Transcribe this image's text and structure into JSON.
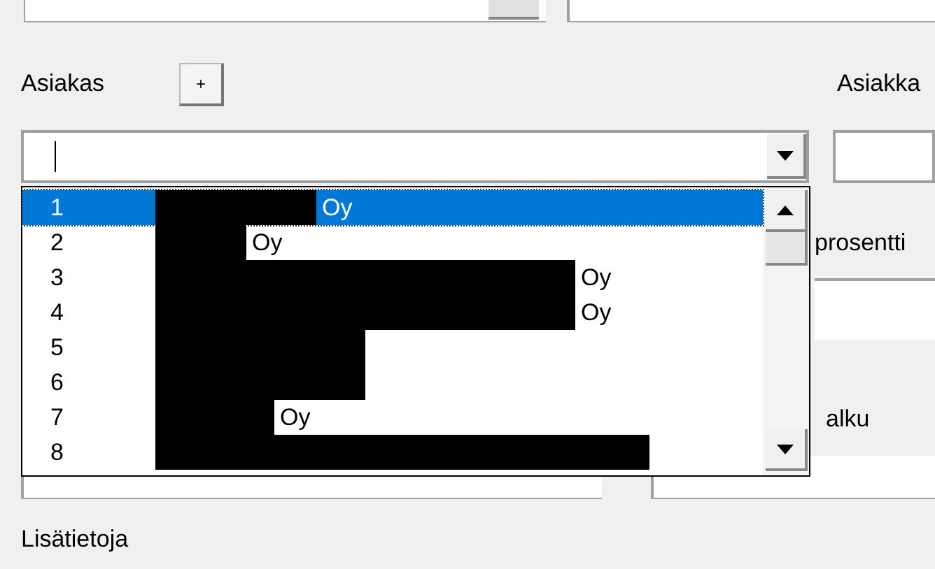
{
  "customer": {
    "label": "Asiakas",
    "add_button": "+"
  },
  "customer_number": {
    "label": "Asiakka"
  },
  "dropdown": {
    "items": [
      {
        "number": "1",
        "suffix": "Oy",
        "redacted": true,
        "selected": true
      },
      {
        "number": "2",
        "suffix": "Oy",
        "redacted": true,
        "selected": false
      },
      {
        "number": "3",
        "suffix": "Oy",
        "redacted": true,
        "selected": false
      },
      {
        "number": "4",
        "suffix": "Oy",
        "redacted": true,
        "selected": false
      },
      {
        "number": "5",
        "redacted": true,
        "selected": false
      },
      {
        "number": "6",
        "redacted": true,
        "selected": false
      },
      {
        "number": "7",
        "suffix": "Oy",
        "redacted": true,
        "selected": false
      },
      {
        "number": "8",
        "redacted": true,
        "selected": false
      }
    ]
  },
  "discount": {
    "label": "prosentti"
  },
  "start": {
    "label": "alku"
  },
  "notes": {
    "label": "Lisätietoja"
  }
}
